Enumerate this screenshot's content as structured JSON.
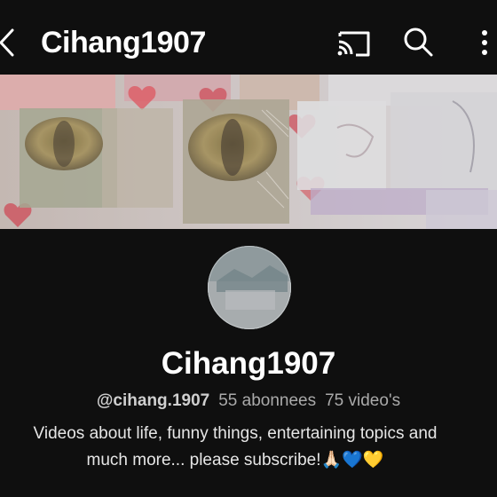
{
  "header": {
    "title": "Cihang1907",
    "back_icon": "chevron-left-icon",
    "cast_icon": "cast-icon",
    "search_icon": "search-icon",
    "more_icon": "more-vertical-icon"
  },
  "channel": {
    "name": "Cihang1907",
    "handle": "@cihang.1907",
    "subscribers": "55 abonnees",
    "videos": "75 video's",
    "description_line1": "Videos about life, funny things, entertaining topics and",
    "description_line2": "much more... please subscribe!🙏🏻💙💛"
  },
  "colors": {
    "background": "#0f0f0f",
    "text": "#ffffff",
    "secondary_text": "#aaaaaa"
  }
}
